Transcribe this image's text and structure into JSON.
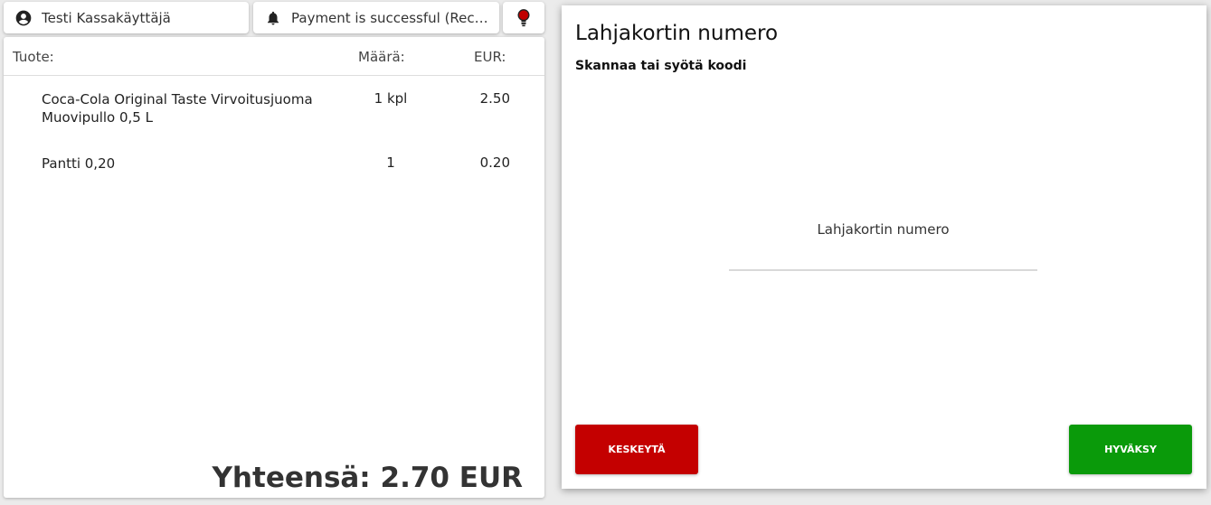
{
  "topbar": {
    "user_name": "Testi Kassakäyttäjä",
    "notification": "Payment is successful (Receipt)",
    "user_icon": "account-circle-icon",
    "notification_icon": "bell-icon",
    "status_icon": "lightbulb-icon",
    "status_color": "#c00000"
  },
  "receipt": {
    "headers": {
      "product": "Tuote:",
      "quantity": "Määrä:",
      "eur": "EUR:"
    },
    "items": [
      {
        "name": "Coca-Cola Original Taste Virvoitusjuoma Muovipullo 0,5 L",
        "quantity": "1 kpl",
        "price": "2.50"
      },
      {
        "name": "Pantti 0,20",
        "quantity": "1",
        "price": "0.20"
      }
    ],
    "total": "Yhteensä: 2.70 EUR"
  },
  "dialog": {
    "title": "Lahjakortin numero",
    "subtitle": "Skannaa tai syötä koodi",
    "field_label": "Lahjakortin numero",
    "field_value": "",
    "cancel_label": "KESKEYTÄ",
    "confirm_label": "HYVÄKSY",
    "cancel_color": "#c40000",
    "confirm_color": "#0a9a0a"
  }
}
